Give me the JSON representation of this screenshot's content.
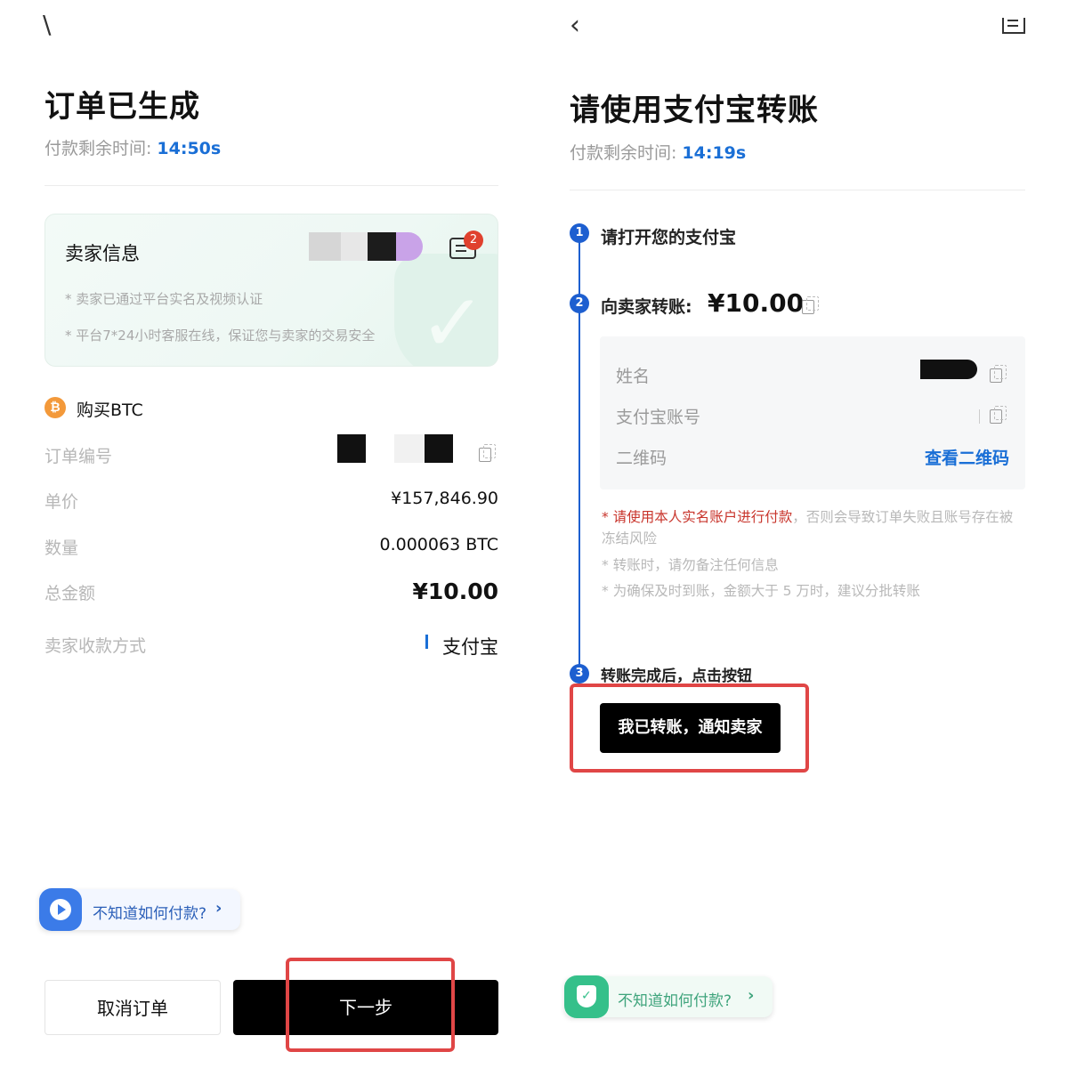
{
  "left": {
    "back_icon": "back-arrow-icon",
    "title": "订单已生成",
    "timer_label": "付款剩余时间:",
    "timer_value": "14:50s",
    "seller": {
      "title": "卖家信息",
      "unread_count": "2",
      "note1": "* 卖家已通过平台实名及视频认证",
      "note2": "* 平台7*24小时客服在线，保证您与卖家的交易安全"
    },
    "buy_label": "购买BTC",
    "btc_symbol": "₿",
    "rows": [
      {
        "label": "订单编号",
        "value": ""
      },
      {
        "label": "单价",
        "value": "¥157,846.90"
      },
      {
        "label": "数量",
        "value": "0.000063 BTC"
      },
      {
        "label": "总金额",
        "value": "¥10.00"
      },
      {
        "label": "卖家收款方式",
        "value": "支付宝"
      }
    ],
    "help_text": "不知道如何付款?",
    "cancel_label": "取消订单",
    "next_label": "下一步"
  },
  "right": {
    "back_icon": "back-arrow-icon",
    "title": "请使用支付宝转账",
    "timer_label": "付款剩余时间:",
    "timer_value": "14:19s",
    "steps": [
      {
        "num": "1",
        "text": "请打开您的支付宝"
      },
      {
        "num": "2",
        "text": "向卖家转账:",
        "amount": "¥10.00"
      },
      {
        "num": "3",
        "text": "转账完成后，点击按钮"
      }
    ],
    "info": {
      "name_label": "姓名",
      "account_label": "支付宝账号",
      "qr_label": "二维码",
      "qr_link": "查看二维码"
    },
    "warnings": {
      "w1_red": "请使用本人实名账户进行付款",
      "w1_rest": "，否则会导致订单失败且账号存在被冻结风险",
      "w2": "转账时，请勿备注任何信息",
      "w3": "为确保及时到账，金额大于 5 万时，建议分批转账"
    },
    "notify_label": "我已转账，通知卖家",
    "help_text": "不知道如何付款?"
  },
  "colors": {
    "accent_blue": "#1a6fd6",
    "step_blue": "#1d5fd0",
    "highlight_red": "#e04646",
    "warning_red": "#c8342b",
    "green": "#35c08a"
  }
}
